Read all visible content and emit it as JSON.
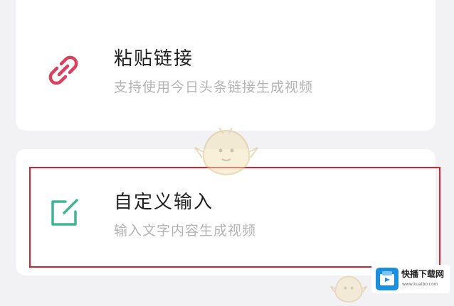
{
  "options": [
    {
      "title": "粘贴链接",
      "description": "支持使用今日头条链接生成视频",
      "icon": "link-icon",
      "icon_color": "#d9415f"
    },
    {
      "title": "自定义输入",
      "description": "输入文字内容生成视频",
      "icon": "edit-icon",
      "icon_color": "#3fb596"
    }
  ],
  "highlight_color": "#d9232a",
  "watermark": {
    "title": "快播下载网",
    "url": "www.kuaibo.com"
  }
}
